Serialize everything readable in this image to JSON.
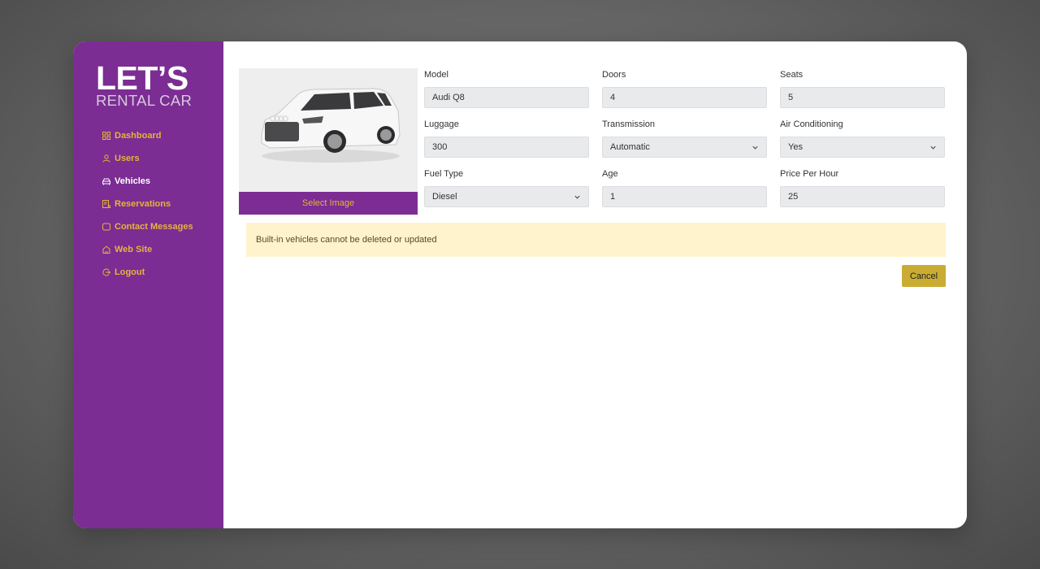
{
  "brand": {
    "logo_line1": "LET’S",
    "logo_line2": "RENTAL CAR"
  },
  "sidebar": {
    "items": [
      {
        "label": "Dashboard",
        "icon": "dashboard-icon",
        "active": false
      },
      {
        "label": "Users",
        "icon": "user-icon",
        "active": false
      },
      {
        "label": "Vehicles",
        "icon": "car-icon",
        "active": true
      },
      {
        "label": "Reservations",
        "icon": "reservation-icon",
        "active": false
      },
      {
        "label": "Contact Messages",
        "icon": "message-icon",
        "active": false
      },
      {
        "label": "Web Site",
        "icon": "home-icon",
        "active": false
      },
      {
        "label": "Logout",
        "icon": "logout-icon",
        "active": false
      }
    ]
  },
  "vehicle_image": {
    "alt": "White Audi SUV",
    "select_label": "Select Image"
  },
  "form": {
    "model": {
      "label": "Model",
      "value": "Audi Q8"
    },
    "doors": {
      "label": "Doors",
      "value": "4"
    },
    "seats": {
      "label": "Seats",
      "value": "5"
    },
    "luggage": {
      "label": "Luggage",
      "value": "300"
    },
    "transmission": {
      "label": "Transmission",
      "value": "Automatic"
    },
    "air_conditioning": {
      "label": "Air Conditioning",
      "value": "Yes"
    },
    "fuel_type": {
      "label": "Fuel Type",
      "value": "Diesel"
    },
    "age": {
      "label": "Age",
      "value": "1"
    },
    "price_per_hour": {
      "label": "Price Per Hour",
      "value": "25"
    }
  },
  "alert": {
    "message": "Built-in vehicles cannot be deleted or updated"
  },
  "actions": {
    "cancel_label": "Cancel"
  },
  "colors": {
    "sidebar_bg": "#7b2d93",
    "nav_text": "#e5b33c",
    "nav_active": "#ffffff",
    "alert_bg": "#fff3cd",
    "cancel_bg": "#c9ad33"
  }
}
